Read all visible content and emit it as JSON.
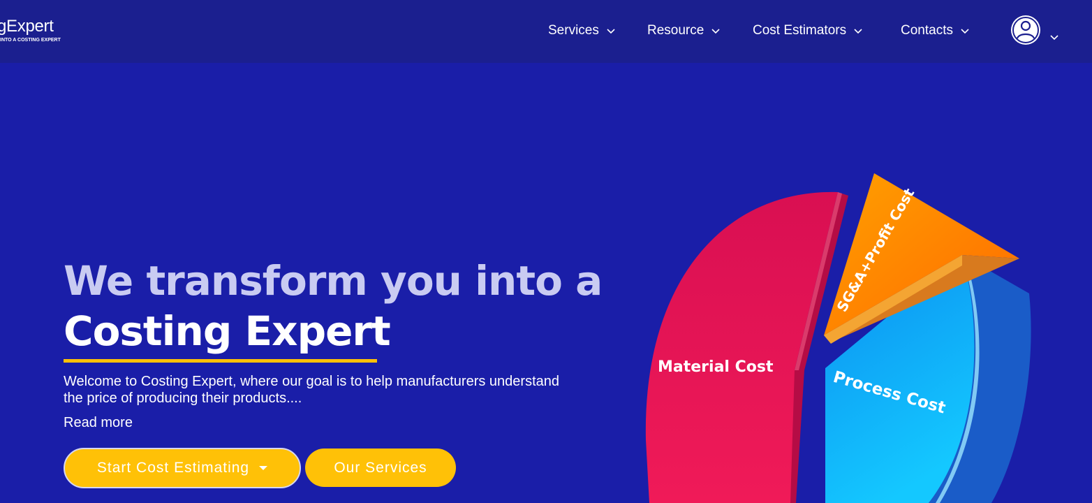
{
  "header": {
    "logo_text": "gExpert",
    "logo_tagline": "INTO A COSTING EXPERT",
    "nav": [
      {
        "label": "Services"
      },
      {
        "label": "Resource"
      },
      {
        "label": "Cost Estimators"
      },
      {
        "label": "Contacts"
      }
    ],
    "user_icon": "user-circle-icon"
  },
  "hero": {
    "headline_line1": "We transform you into a",
    "headline_line2": "Costing Expert",
    "welcome": "Welcome to Costing Expert, where our goal is to help manufacturers understand the price of producing their products....",
    "read_more": "Read more",
    "btn_estimate": "Start Cost Estimating",
    "btn_services": "Our Services"
  },
  "pie": {
    "labels": {
      "material": "Material Cost",
      "sga": "SG&A+Profit Cost",
      "process": "Process Cost"
    }
  },
  "colors": {
    "background": "#1a1ea8",
    "header": "#1b1f8f",
    "accent": "#ffc107",
    "material": "#e0144e",
    "sga": "#ff8a00",
    "process": "#12a3f0"
  }
}
